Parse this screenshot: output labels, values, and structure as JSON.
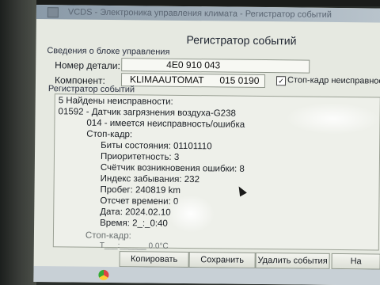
{
  "window": {
    "title": "VCDS - Электроника управления климата - Регистратор событий"
  },
  "heading": "Регистратор событий",
  "control_unit": {
    "group_title": "Сведения о блоке управления",
    "part_number_label": "Номер детали:",
    "part_number_value": "4E0 910 043",
    "component_label": "Компонент:",
    "component_value": "KLIMAAUTOMAT      015 0190",
    "freeze_frame_checkbox_label": "Стоп-кадр неисправностей",
    "freeze_frame_checked": true
  },
  "log": {
    "group_title": "Регистратор событий",
    "lines": [
      "5 Найдены неисправности:",
      "01592 - Датчик загрязнения воздуха-G238",
      "014 - имеется неисправность/ошибка",
      "Стоп-кадр:",
      "Биты состояния: 01101110",
      "Приоритетность: 3",
      "Счётчик возникновения ошибки: 8",
      "Индекс забывания: 232",
      "Пробег: 240819 km",
      "Отсчет времени: 0",
      "Дата: 2024.02.10",
      "Время: 2_:_0:40",
      "Стоп-кадр:",
      "Т___:______ 0.0°C"
    ]
  },
  "buttons": {
    "copy": "Копировать",
    "save": "Сохранить",
    "delete": "Удалить события",
    "next": "На"
  }
}
